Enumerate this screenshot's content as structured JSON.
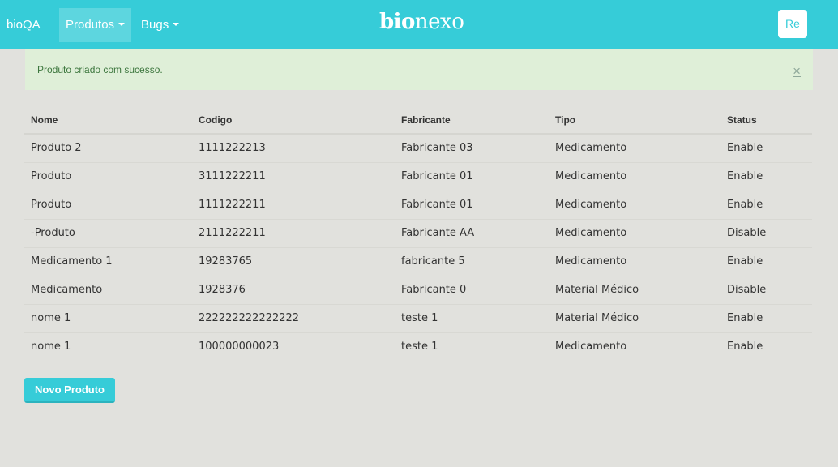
{
  "navbar": {
    "brand": "bioQA",
    "items": [
      {
        "label": "Produtos",
        "active": true
      },
      {
        "label": "Bugs",
        "active": false
      }
    ],
    "logo_bold": "bio",
    "logo_light": "nexo",
    "user_initials": "Re"
  },
  "alert": {
    "message": "Produto criado com sucesso.",
    "close": "×"
  },
  "table": {
    "headers": [
      "Nome",
      "Codigo",
      "Fabricante",
      "Tipo",
      "Status"
    ],
    "rows": [
      [
        "Produto 2",
        "1111222213",
        "Fabricante 03",
        "Medicamento",
        "Enable"
      ],
      [
        "Produto",
        "3111222211",
        "Fabricante 01",
        "Medicamento",
        "Enable"
      ],
      [
        "Produto",
        "1111222211",
        "Fabricante 01",
        "Medicamento",
        "Enable"
      ],
      [
        "-Produto",
        "2111222211",
        "Fabricante AA",
        "Medicamento",
        "Disable"
      ],
      [
        "Medicamento 1",
        "19283765",
        "fabricante 5",
        "Medicamento",
        "Enable"
      ],
      [
        "Medicamento",
        "1928376",
        "Fabricante 0",
        "Material Médico",
        "Disable"
      ],
      [
        "nome 1",
        "222222222222222",
        "teste 1",
        "Material Médico",
        "Enable"
      ],
      [
        "nome 1",
        "100000000023",
        "teste 1",
        "Medicamento",
        "Enable"
      ]
    ]
  },
  "actions": {
    "new_product": "Novo Produto"
  },
  "colors": {
    "accent": "#36ccd8",
    "background": "#e1e1dd",
    "alert_bg": "#dfefd8",
    "alert_text": "#3c763d"
  }
}
